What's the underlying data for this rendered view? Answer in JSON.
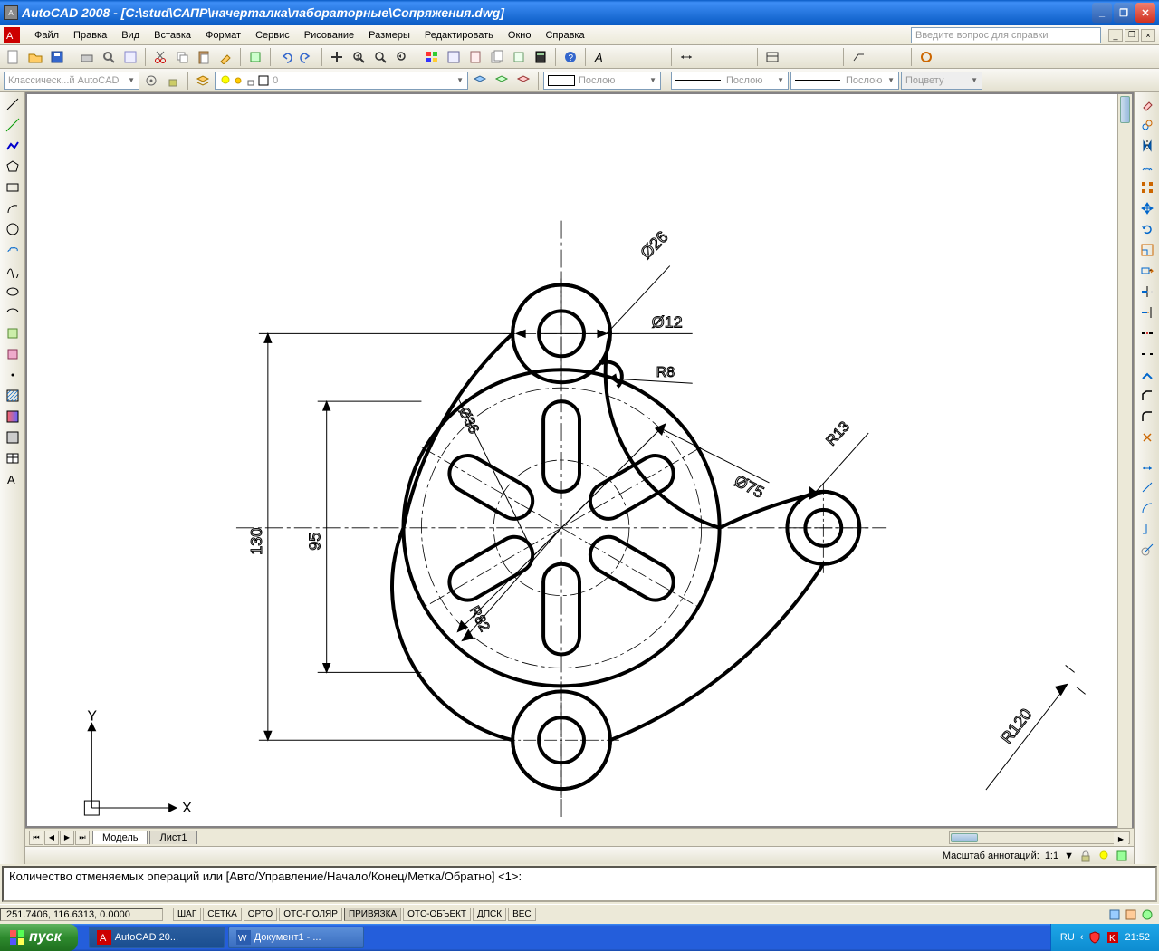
{
  "title": "AutoCAD 2008 - [C:\\stud\\САПР\\начерталка\\лабораторные\\Сопряжения.dwg]",
  "menu": [
    "Файл",
    "Правка",
    "Вид",
    "Вставка",
    "Формат",
    "Сервис",
    "Рисование",
    "Размеры",
    "Редактировать",
    "Окно",
    "Справка"
  ],
  "help_placeholder": "Введите вопрос для справки",
  "workspace_combo": "Классическ...й AutoCAD",
  "layer_combo": "0",
  "color_combo": "Послою",
  "linetype_combo": "Послою",
  "lineweight_combo": "Послою",
  "plotstyle_combo": "Поцвету",
  "tabs": {
    "model": "Модель",
    "sheet1": "Лист1"
  },
  "anno_label": "Масштаб аннотаций:",
  "anno_scale": "1:1",
  "cmd_line": "Количество отменяемых операций или [Авто/Управление/Начало/Конец/Метка/Обратно] <1>:",
  "coords": "251.7406, 116.6313, 0.0000",
  "status_toggles": [
    "ШАГ",
    "СЕТКА",
    "ОРТО",
    "ОТС-ПОЛЯР",
    "ПРИВЯЗКА",
    "ОТС-ОБЪЕКТ",
    "ДПСК",
    "ВЕС"
  ],
  "status_on": [
    false,
    false,
    false,
    false,
    true,
    false,
    false,
    false
  ],
  "lang": "RU",
  "clock": "21:52",
  "start": "пуск",
  "task_acad": "AutoCAD 20...",
  "task_word": "Документ1 - ...",
  "ucs": {
    "x": "X",
    "y": "Y"
  },
  "dims": {
    "d26": "Ø26",
    "d12": "Ø12",
    "r8": "R8",
    "r13": "R13",
    "d75": "Ø75",
    "d36": "Ø36",
    "r82": "R82",
    "h130": "130",
    "h95": "95",
    "r120": "R120"
  }
}
